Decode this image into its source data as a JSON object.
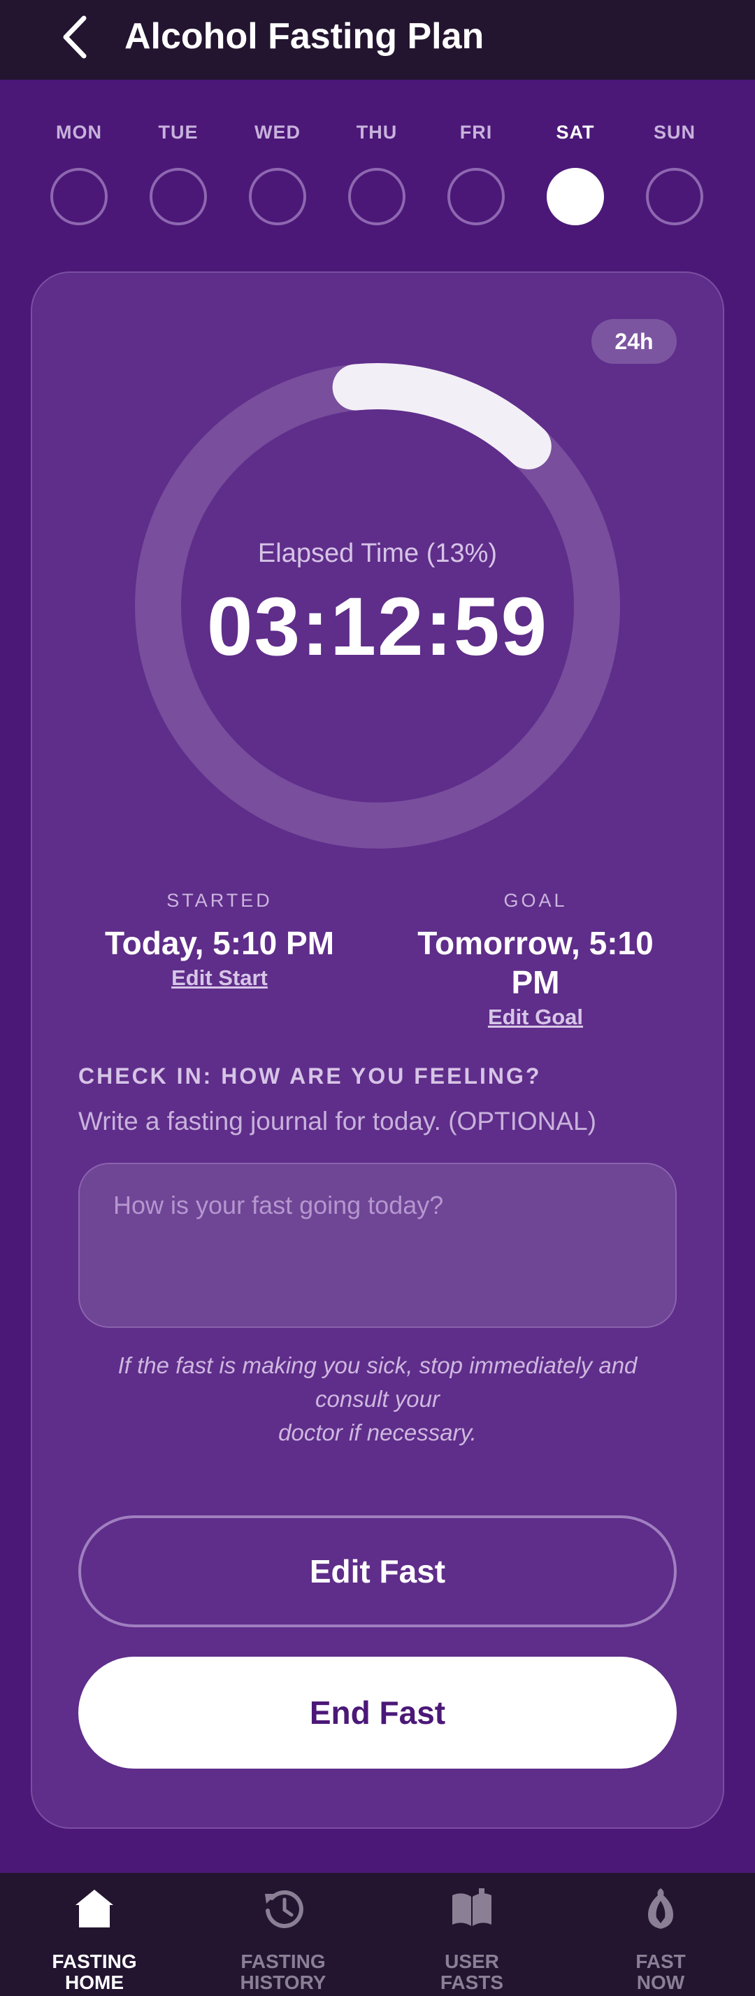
{
  "header": {
    "title": "Alcohol Fasting Plan"
  },
  "week": {
    "days": [
      {
        "label": "MON",
        "active": false
      },
      {
        "label": "TUE",
        "active": false
      },
      {
        "label": "WED",
        "active": false
      },
      {
        "label": "THU",
        "active": false
      },
      {
        "label": "FRI",
        "active": false
      },
      {
        "label": "SAT",
        "active": true
      },
      {
        "label": "SUN",
        "active": false
      }
    ]
  },
  "fast": {
    "goal_badge": "24h",
    "elapsed_label": "Elapsed Time (13%)",
    "progress_fraction": 0.13,
    "timer": "03:12:59",
    "started_label": "STARTED",
    "started_value": "Today, 5:10 PM",
    "edit_start": "Edit Start",
    "goal_label": "GOAL",
    "goal_value": "Tomorrow, 5:10 PM",
    "edit_goal": "Edit Goal"
  },
  "checkin": {
    "title": "CHECK IN: HOW ARE YOU FEELING?",
    "subtitle": "Write a fasting journal for today. (OPTIONAL)",
    "placeholder": "How is your fast going today?",
    "disclaimer_line1": "If the fast is making you sick, stop immediately and",
    "disclaimer_line2": "consult your",
    "disclaimer_line3": "doctor if necessary."
  },
  "actions": {
    "edit_fast": "Edit Fast",
    "end_fast": "End Fast"
  },
  "nav": {
    "items": [
      {
        "label": "FASTING\nHOME",
        "icon": "home-icon",
        "active": true
      },
      {
        "label": "FASTING\nHISTORY",
        "icon": "history-icon",
        "active": false
      },
      {
        "label": "USER\nFASTS",
        "icon": "book-icon",
        "active": false
      },
      {
        "label": "FAST\nNOW",
        "icon": "fast-now-icon",
        "active": false
      }
    ]
  },
  "colors": {
    "background": "#4b1878",
    "card": "#5f2d8a",
    "bar": "#231530",
    "accent": "#ffffff"
  }
}
